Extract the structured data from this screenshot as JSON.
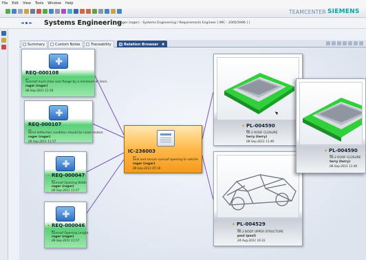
{
  "menu": [
    "File",
    "Edit",
    "View",
    "Tools",
    "Window",
    "Help"
  ],
  "branding": {
    "teamcenter": "TEAMCENTER",
    "siemens": "SIEMENS"
  },
  "header": {
    "back_label": "◄ ▪ ►",
    "title": "Systems Engineering",
    "subtitle": "( roger (roger) - Systems Engineering / Requirements Engineer [ IMC - 2005/5996 ] )"
  },
  "tabs": [
    {
      "label": "Summary"
    },
    {
      "label": "Custom Notes"
    },
    {
      "label": "Traceability"
    },
    {
      "label": "Relation Browser",
      "close": "✖"
    }
  ],
  "requirements": [
    {
      "id": "REQ-000108",
      "type": "aa",
      "text": "Sunroof must clear seal flange by a minimum of 3mm.",
      "owner": "roger (roger)",
      "date": "08-Sep-2011 11:58",
      "star": false
    },
    {
      "id": "REQ-000107",
      "type": "aa",
      "text": "Wind deflection condition should be noise limited.",
      "owner": "roger (roger)",
      "date": "08-Sep-2011 11:57",
      "star": false
    },
    {
      "id": "REQ-000047",
      "type": "aa",
      "text": "Sunroof Opening Width",
      "owner": "roger (roger)",
      "date": "08-Sep-2011 11:57",
      "star": true
    },
    {
      "id": "REQ-000046",
      "type": "aa",
      "text": "Sunroof Opening Lenght",
      "owner": "roger (roger)",
      "date": "08-Sep-2011 11:57",
      "star": true
    }
  ],
  "center": {
    "id": "IC-236003",
    "type": "aa",
    "text": "Seal and secure sunroof opening to vehicle",
    "owner": "roger (roger)",
    "date": "08-Sep-2011 05:18"
  },
  "parts": [
    {
      "id": "PL-004590",
      "type": "aa",
      "text": "90.2 ROOF CLOSURE",
      "owner": "terry (terry)",
      "date": "08-Sep-2011 11:40"
    },
    {
      "id": "PL-004529",
      "type": "aa",
      "text": "90.2 BODY UPPER STRUCTURE",
      "owner": "paul (paul)",
      "date": "24-Aug-2011 16:33"
    },
    {
      "id": "PL-004590",
      "type": "aa",
      "text": "90.2 ROOF CLOSURE",
      "owner": "terry (terry)",
      "date": "08-Sep-2011 11:40"
    }
  ],
  "colors": {
    "link": "#7a4fc8",
    "req_green": "#5bd079",
    "ic_orange": "#f59a1d",
    "active_tab": "#2c4f86"
  }
}
